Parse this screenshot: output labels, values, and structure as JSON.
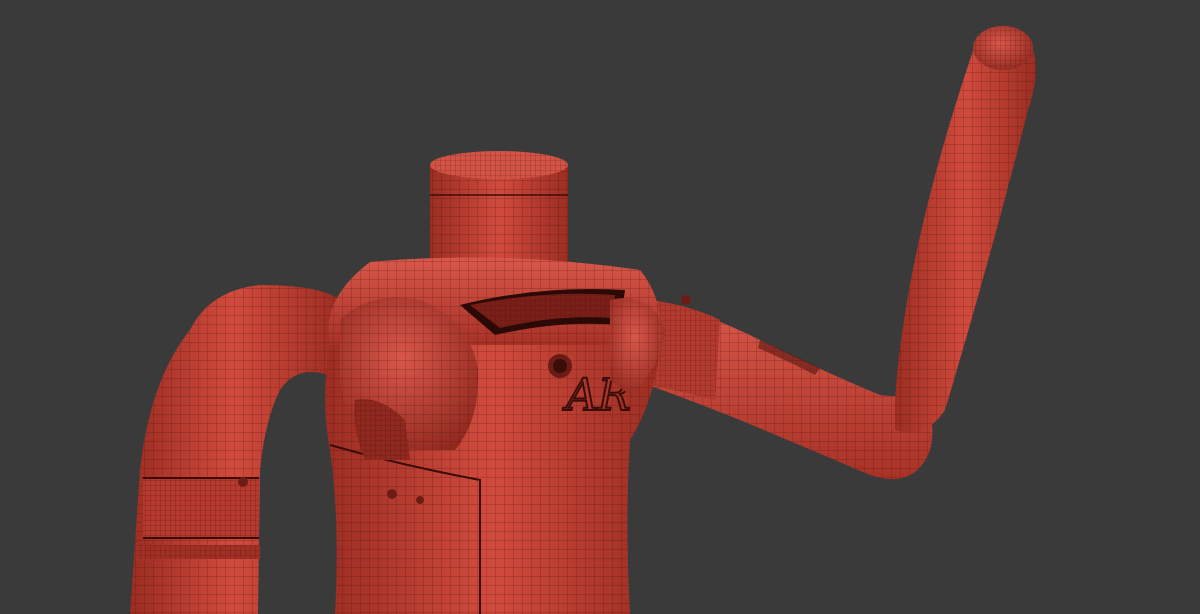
{
  "scene": {
    "background_color": "#3a3a3a",
    "mesh_color": "#c0392b",
    "mesh_shadow_color": "#7a1f17",
    "mesh_highlight_color": "#d9574a",
    "wire_color": "#3a0d0a",
    "chest_logo": "AR"
  }
}
